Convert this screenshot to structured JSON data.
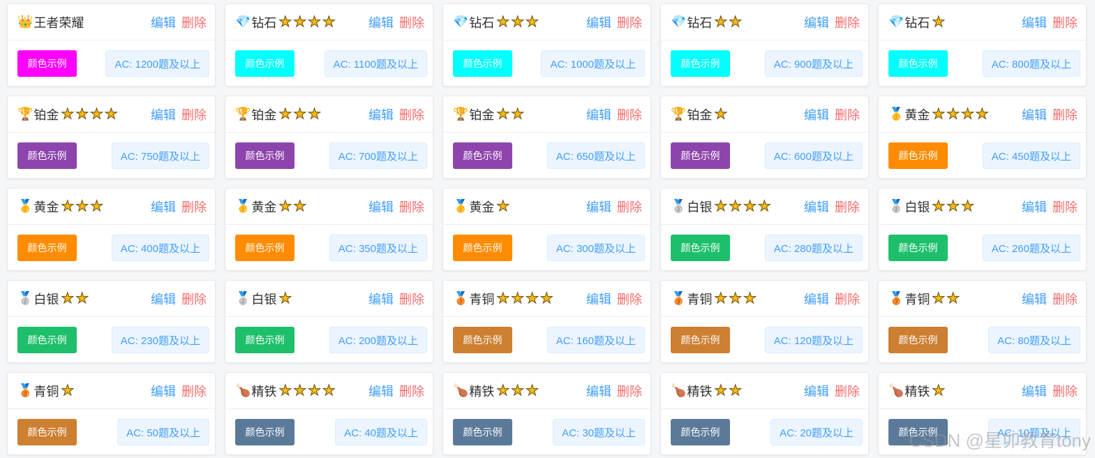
{
  "labels": {
    "edit": "编辑",
    "delete": "删除",
    "color_sample": "颜色示例"
  },
  "star_glyph": "★",
  "watermark": "CSDN @星卯教育tony",
  "cards": [
    {
      "icon": "👑",
      "icon_name": "crown-icon",
      "name": "王者荣耀",
      "stars": 0,
      "color": "#ff00ff",
      "ac": "AC: 1200题及以上"
    },
    {
      "icon": "💎",
      "icon_name": "diamond-icon",
      "name": "钻石",
      "stars": 4,
      "color": "#00ffff",
      "ac": "AC: 1100题及以上"
    },
    {
      "icon": "💎",
      "icon_name": "diamond-icon",
      "name": "钻石",
      "stars": 3,
      "color": "#00ffff",
      "ac": "AC: 1000题及以上"
    },
    {
      "icon": "💎",
      "icon_name": "diamond-icon",
      "name": "钻石",
      "stars": 2,
      "color": "#00ffff",
      "ac": "AC: 900题及以上"
    },
    {
      "icon": "💎",
      "icon_name": "diamond-icon",
      "name": "钻石",
      "stars": 1,
      "color": "#00ffff",
      "ac": "AC: 800题及以上"
    },
    {
      "icon": "🏆",
      "icon_name": "trophy-icon",
      "name": "铂金",
      "stars": 4,
      "color": "#8e44ad",
      "ac": "AC: 750题及以上"
    },
    {
      "icon": "🏆",
      "icon_name": "trophy-icon",
      "name": "铂金",
      "stars": 3,
      "color": "#8e44ad",
      "ac": "AC: 700题及以上"
    },
    {
      "icon": "🏆",
      "icon_name": "trophy-icon",
      "name": "铂金",
      "stars": 2,
      "color": "#8e44ad",
      "ac": "AC: 650题及以上"
    },
    {
      "icon": "🏆",
      "icon_name": "trophy-icon",
      "name": "铂金",
      "stars": 1,
      "color": "#8e44ad",
      "ac": "AC: 600题及以上"
    },
    {
      "icon": "🥇",
      "icon_name": "gold-medal-icon",
      "name": "黄金",
      "stars": 4,
      "color": "#ff8c00",
      "ac": "AC: 450题及以上"
    },
    {
      "icon": "🥇",
      "icon_name": "gold-medal-icon",
      "name": "黄金",
      "stars": 3,
      "color": "#ff8c00",
      "ac": "AC: 400题及以上"
    },
    {
      "icon": "🥇",
      "icon_name": "gold-medal-icon",
      "name": "黄金",
      "stars": 2,
      "color": "#ff8c00",
      "ac": "AC: 350题及以上"
    },
    {
      "icon": "🥇",
      "icon_name": "gold-medal-icon",
      "name": "黄金",
      "stars": 1,
      "color": "#ff8c00",
      "ac": "AC: 300题及以上"
    },
    {
      "icon": "🥈",
      "icon_name": "silver-medal-icon",
      "name": "白银",
      "stars": 4,
      "color": "#1ebf6b",
      "ac": "AC: 280题及以上"
    },
    {
      "icon": "🥈",
      "icon_name": "silver-medal-icon",
      "name": "白银",
      "stars": 3,
      "color": "#1ebf6b",
      "ac": "AC: 260题及以上"
    },
    {
      "icon": "🥈",
      "icon_name": "silver-medal-icon",
      "name": "白银",
      "stars": 2,
      "color": "#1ebf6b",
      "ac": "AC: 230题及以上"
    },
    {
      "icon": "🥈",
      "icon_name": "silver-medal-icon",
      "name": "白银",
      "stars": 1,
      "color": "#1ebf6b",
      "ac": "AC: 200题及以上"
    },
    {
      "icon": "🥉",
      "icon_name": "bronze-medal-icon",
      "name": "青铜",
      "stars": 4,
      "color": "#cd7f32",
      "ac": "AC: 160题及以上"
    },
    {
      "icon": "🥉",
      "icon_name": "bronze-medal-icon",
      "name": "青铜",
      "stars": 3,
      "color": "#cd7f32",
      "ac": "AC: 120题及以上"
    },
    {
      "icon": "🥉",
      "icon_name": "bronze-medal-icon",
      "name": "青铜",
      "stars": 2,
      "color": "#cd7f32",
      "ac": "AC: 80题及以上"
    },
    {
      "icon": "🥉",
      "icon_name": "bronze-medal-icon",
      "name": "青铜",
      "stars": 1,
      "color": "#cd7f32",
      "ac": "AC: 50题及以上"
    },
    {
      "icon": "🍗",
      "icon_name": "drumstick-icon",
      "name": "精铁",
      "stars": 4,
      "color": "#5b7a99",
      "ac": "AC: 40题及以上"
    },
    {
      "icon": "🍗",
      "icon_name": "drumstick-icon",
      "name": "精铁",
      "stars": 3,
      "color": "#5b7a99",
      "ac": "AC: 30题及以上"
    },
    {
      "icon": "🍗",
      "icon_name": "drumstick-icon",
      "name": "精铁",
      "stars": 2,
      "color": "#5b7a99",
      "ac": "AC: 20题及以上"
    },
    {
      "icon": "🍗",
      "icon_name": "drumstick-icon",
      "name": "精铁",
      "stars": 1,
      "color": "#5b7a99",
      "ac": "AC: 10题及以上"
    }
  ]
}
